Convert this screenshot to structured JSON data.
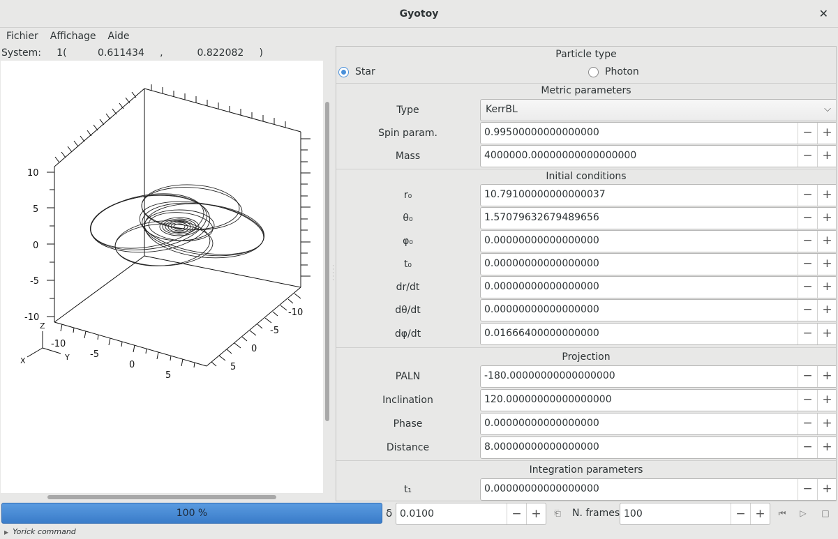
{
  "window": {
    "title": "Gyotoy"
  },
  "menu": [
    {
      "label": "Fichier"
    },
    {
      "label": "Affichage"
    },
    {
      "label": "Aide"
    }
  ],
  "status": {
    "text": "System:     1(          0.611434     ,           0.822082     )"
  },
  "plot": {
    "ticks_z": [
      "10",
      "5",
      "0",
      "-5",
      "-10"
    ],
    "ticks_y": [
      "-10",
      "-5",
      "0",
      "5"
    ],
    "ticks_x": [
      "-10",
      "-5",
      "0",
      "5"
    ],
    "axis_z": "Z",
    "axis_y": "Y",
    "axis_x": "X"
  },
  "particle": {
    "header": "Particle type",
    "options": [
      {
        "label": "Star",
        "selected": true
      },
      {
        "label": "Photon",
        "selected": false
      }
    ]
  },
  "metric": {
    "header": "Metric parameters",
    "type_label": "Type",
    "type_value": "KerrBL",
    "spin_label": "Spin param.",
    "spin_value": "0.99500000000000000",
    "mass_label": "Mass",
    "mass_value": "4000000.00000000000000000"
  },
  "initial": {
    "header": "Initial conditions",
    "rows": [
      {
        "label": "r₀",
        "value": "10.79100000000000037"
      },
      {
        "label": "θ₀",
        "value": "1.57079632679489656"
      },
      {
        "label": "φ₀",
        "value": "0.00000000000000000"
      },
      {
        "label": "t₀",
        "value": "0.00000000000000000"
      },
      {
        "label": "dr/dt",
        "value": "0.00000000000000000"
      },
      {
        "label": "dθ/dt",
        "value": "0.00000000000000000"
      },
      {
        "label": "dφ/dt",
        "value": "0.01666400000000000"
      }
    ]
  },
  "projection": {
    "header": "Projection",
    "rows": [
      {
        "label": "PALN",
        "value": "-180.00000000000000000"
      },
      {
        "label": "Inclination",
        "value": "120.00000000000000000"
      },
      {
        "label": "Phase",
        "value": "0.00000000000000000"
      },
      {
        "label": "Distance",
        "value": "8.00000000000000000"
      }
    ]
  },
  "integration": {
    "header": "Integration parameters",
    "rows": [
      {
        "label": "t₁",
        "value": "0.00000000000000000"
      }
    ]
  },
  "bottom": {
    "progress_text": "100 %",
    "progress_fraction": 1.0,
    "delta_label": "δ",
    "delta_value": "0.0100",
    "nframes_label": "N. frames",
    "nframes_value": "100",
    "minus": "−",
    "plus": "+"
  },
  "yorick": {
    "label": "Yorick command"
  }
}
